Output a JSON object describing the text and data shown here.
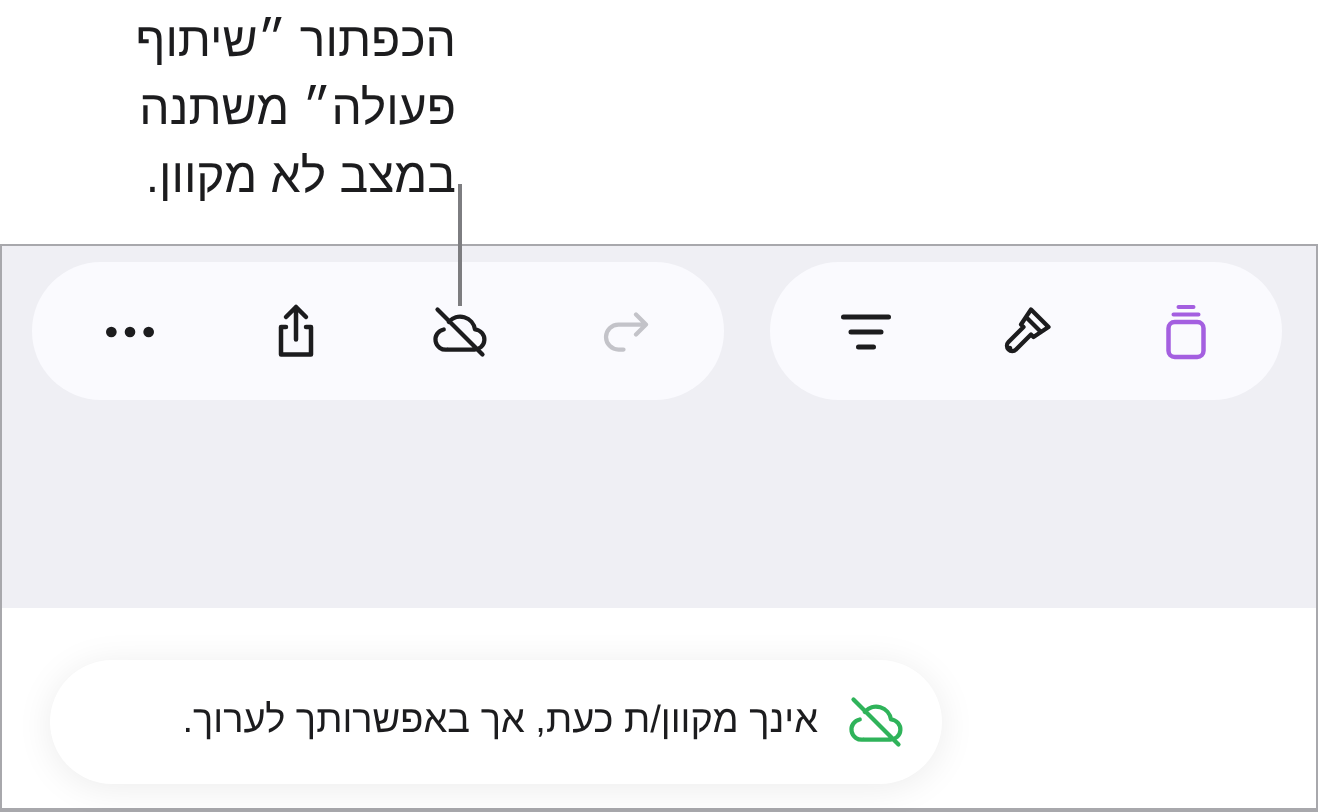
{
  "callout": {
    "text": "הכפתור ״שיתוף פעולה״ משתנה במצב לא מקוון."
  },
  "toolbars": [
    {
      "buttons": [
        {
          "kind": "more",
          "disabled": false,
          "selected": false
        },
        {
          "kind": "share",
          "disabled": false,
          "selected": false
        },
        {
          "kind": "cloud-offline",
          "disabled": false,
          "selected": false
        },
        {
          "kind": "redo",
          "disabled": true,
          "selected": false
        }
      ]
    },
    {
      "buttons": [
        {
          "kind": "sort",
          "disabled": false,
          "selected": false
        },
        {
          "kind": "brush",
          "disabled": false,
          "selected": false
        },
        {
          "kind": "stack",
          "disabled": false,
          "selected": true
        }
      ]
    }
  ],
  "notice": {
    "text": "אינך מקוון/ת כעת, אך באפשרותך לערוך."
  }
}
